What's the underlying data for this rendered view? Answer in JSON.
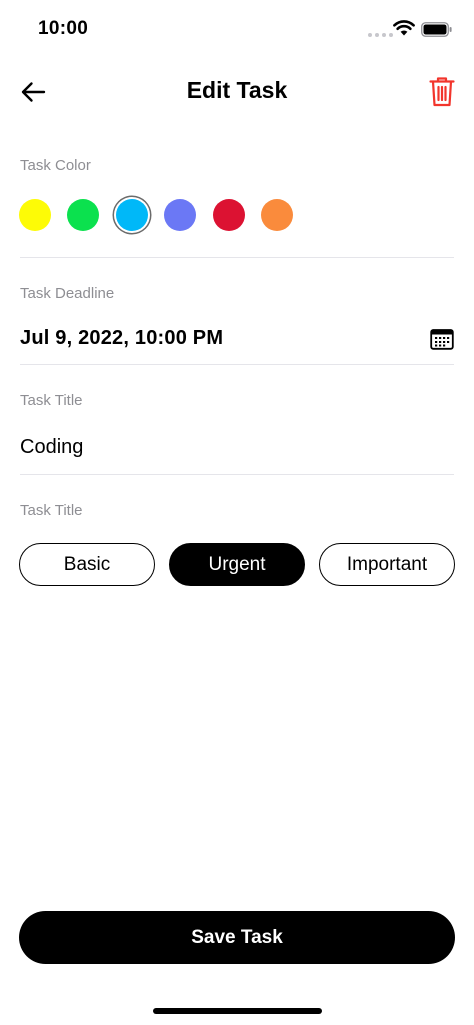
{
  "status_bar": {
    "time": "10:00"
  },
  "header": {
    "title": "Edit Task",
    "back_icon": "arrow-left-icon",
    "delete_icon": "trash-icon",
    "delete_color": "#f2352c"
  },
  "task_color": {
    "label": "Task Color",
    "swatches": [
      {
        "name": "yellow",
        "hex": "#fdfb06"
      },
      {
        "name": "green",
        "hex": "#0be14e"
      },
      {
        "name": "blue",
        "hex": "#00b8f8"
      },
      {
        "name": "periwinkle",
        "hex": "#6b78f5"
      },
      {
        "name": "red",
        "hex": "#dc1232"
      },
      {
        "name": "orange",
        "hex": "#fa8b3c"
      }
    ],
    "selected": "blue"
  },
  "deadline": {
    "label": "Task Deadline",
    "value": "Jul 9, 2022, 10:00 PM",
    "icon": "calendar-icon"
  },
  "title_field": {
    "label": "Task Title",
    "value": "Coding"
  },
  "priority": {
    "label": "Task Title",
    "options": [
      "Basic",
      "Urgent",
      "Important"
    ],
    "selected": "Urgent"
  },
  "save_label": "Save Task"
}
